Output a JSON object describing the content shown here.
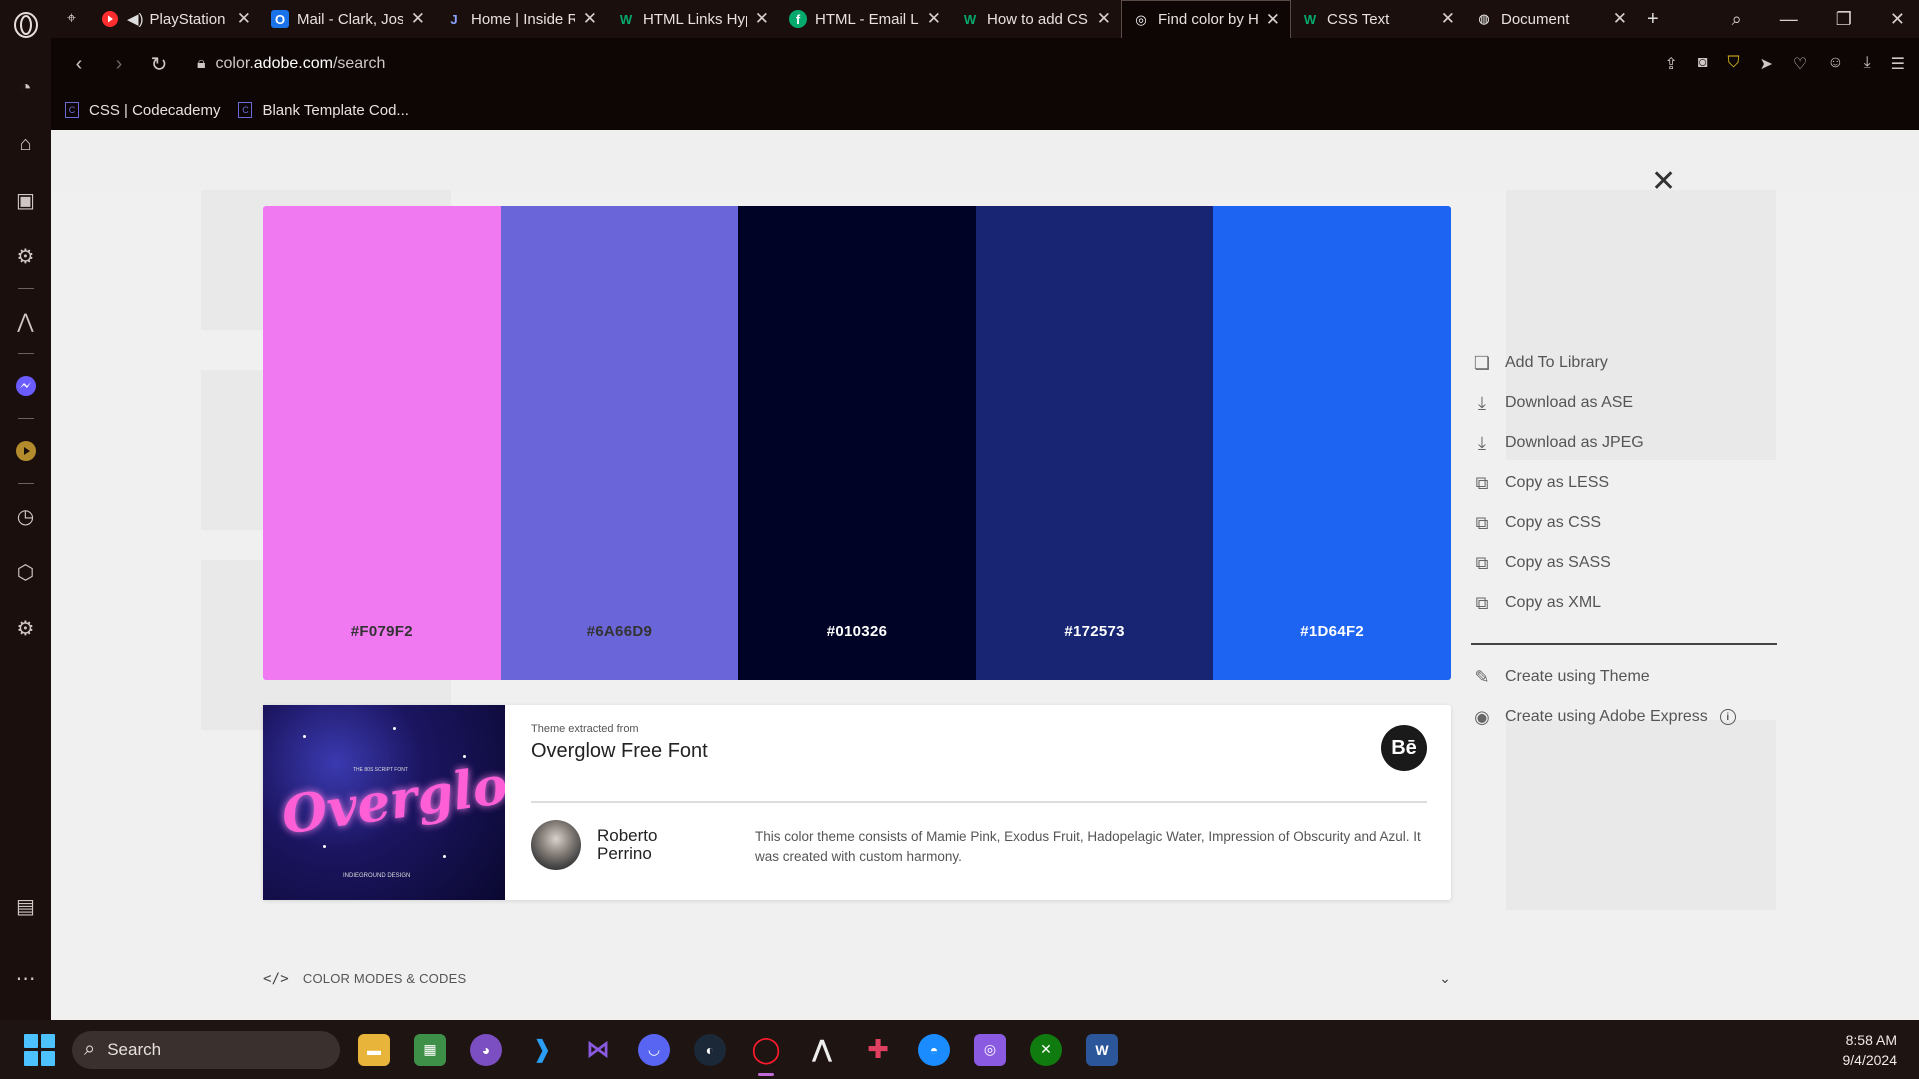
{
  "browser": {
    "tabs": [
      {
        "title": "PlayStation",
        "icon": "youtube-icon",
        "color": "#ff2d2d",
        "active": false
      },
      {
        "title": "Mail - Clark, Jos",
        "icon": "outlook-icon",
        "color": "#1a73e8",
        "active": false
      },
      {
        "title": "Home | Inside R",
        "icon": "j-icon",
        "color": "#8aa4ff",
        "active": false
      },
      {
        "title": "HTML Links Hyp",
        "icon": "w3schools-icon",
        "color": "#04aa6d",
        "active": false
      },
      {
        "title": "HTML - Email Li",
        "icon": "codecademy-icon",
        "color": "#04aa6d",
        "active": false
      },
      {
        "title": "How to add CS",
        "icon": "w3schools-icon",
        "color": "#04aa6d",
        "active": false
      },
      {
        "title": "Find color by He",
        "icon": "adobe-color-icon",
        "color": "#ffffff",
        "active": true
      },
      {
        "title": "CSS Text",
        "icon": "w3schools-icon",
        "color": "#04aa6d",
        "active": false
      },
      {
        "title": "Document",
        "icon": "globe-icon",
        "color": "#ffffff",
        "active": false
      }
    ],
    "url_prefix": "color.",
    "url_host": "adobe.com",
    "url_path": "/search",
    "bookmarks": [
      {
        "label": "CSS | Codecademy"
      },
      {
        "label": "Blank Template Cod..."
      }
    ]
  },
  "palette": {
    "swatches": [
      {
        "hex": "#F079F2",
        "color": "#F079F2",
        "text_color": "#333333"
      },
      {
        "hex": "#6A66D9",
        "color": "#6A66D9",
        "text_color": "#333333"
      },
      {
        "hex": "#010326",
        "color": "#010326",
        "text_color": "#ffffff"
      },
      {
        "hex": "#172573",
        "color": "#172573",
        "text_color": "#ffffff"
      },
      {
        "hex": "#1D64F2",
        "color": "#1D64F2",
        "text_color": "#ffffff"
      }
    ]
  },
  "theme": {
    "extracted_label": "Theme extracted from",
    "title": "Overglow Free Font",
    "thumb_text": "Overglow",
    "thumb_small": "THE 80S SCRIPT FONT",
    "thumb_base": "INDIEGROUND DESIGN",
    "source_badge": "Bē",
    "author": "Roberto Perrino",
    "description": "This color theme consists of Mamie Pink, Exodus Fruit, Hadopelagic Water, Impression of Obscurity and Azul. It was created with custom harmony."
  },
  "actions": {
    "items": [
      {
        "label": "Add To Library",
        "icon": "library-icon"
      },
      {
        "label": "Download as ASE",
        "icon": "download-icon"
      },
      {
        "label": "Download as JPEG",
        "icon": "download-icon"
      },
      {
        "label": "Copy as LESS",
        "icon": "copy-icon"
      },
      {
        "label": "Copy as CSS",
        "icon": "copy-icon"
      },
      {
        "label": "Copy as SASS",
        "icon": "copy-icon"
      },
      {
        "label": "Copy as XML",
        "icon": "copy-icon"
      }
    ],
    "create_theme": "Create using Theme",
    "create_express": "Create using Adobe Express"
  },
  "color_modes_label": "COLOR MODES & CODES",
  "taskbar": {
    "search_label": "Search",
    "time": "8:58 AM",
    "date": "9/4/2024"
  }
}
